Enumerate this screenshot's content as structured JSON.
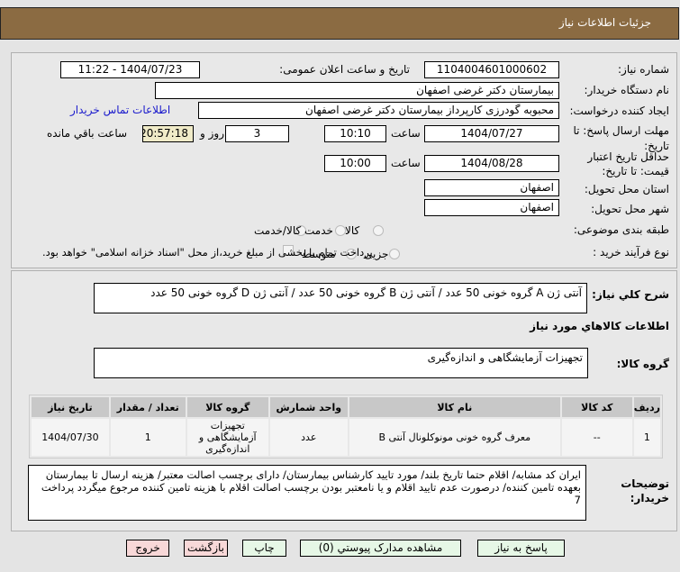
{
  "header": {
    "title": "جزئیات اطلاعات نیاز"
  },
  "form": {
    "need_number_label": "شماره نیاز:",
    "need_number": "1104004601000602",
    "announce_label": "تاریخ و ساعت اعلان عمومی:",
    "announce_value": "1404/07/23 - 11:22",
    "buyer_label": "نام دستگاه خریدار:",
    "buyer": "بیمارستان دکتر غرضی اصفهان",
    "creator_label": "ایجاد کننده درخواست:",
    "creator": "محبوبه گودرزی کارپرداز بیمارستان دکتر غرضی اصفهان",
    "contact_link": "اطلاعات تماس خریدار",
    "deadline_label_1": "مهلت ارسال پاسخ: تا",
    "deadline_label_2": "تاریخ:",
    "deadline_date": "1404/07/27",
    "time_label": "ساعت",
    "deadline_time": "10:10",
    "days": "3",
    "days_label": "روز و",
    "remaining": "20:57:18",
    "remaining_label": "ساعت باقي مانده",
    "validity_label_1": "حداقل تاریخ اعتبار",
    "validity_label_2": "قیمت: تا تاریخ:",
    "validity_date": "1404/08/28",
    "validity_time": "10:00",
    "province_label": "استان محل تحویل:",
    "province": "اصفهان",
    "city_label": "شهر محل تحویل:",
    "city": "اصفهان",
    "category_label": "طبقه بندی موضوعی:",
    "category_options": [
      "کالا",
      "خدمت",
      "کالا/خدمت"
    ],
    "process_label": "نوع فرآیند خرید :",
    "process_options": [
      "جزیی",
      "متوسط"
    ],
    "payment_note": "پرداخت تمام یا بخشی از مبلغ خرید،از محل \"اسناد خزانه اسلامی\" خواهد بود."
  },
  "description": {
    "label": "شرح کلي نياز:",
    "value": "آنتی ژن A گروه خونی 50 عدد / آنتی ژن B گروه خونی 50 عدد / آنتی ژن D گروه خونی 50 عدد"
  },
  "goods_title": "اطلاعات كالاهاي مورد نياز",
  "goods_group": {
    "label": "گروه کالا:",
    "value": "تجهیزات آزمایشگاهی و اندازه‌گیری"
  },
  "table": {
    "headers": [
      "ردیف",
      "کد کالا",
      "نام کالا",
      "واحد شمارش",
      "گروه کالا",
      "تعداد / مقدار",
      "تاریخ نیاز"
    ],
    "rows": [
      [
        "1",
        "--",
        "معرف گروه خونی مونوکلونال آنتی B",
        "عدد",
        "تجهیزات آزمایشگاهی و اندازه‌گیری",
        "1",
        "1404/07/30"
      ]
    ]
  },
  "notes": {
    "label_1": "توضیحات",
    "label_2": "خریدار:",
    "value": "ایران کد مشابه/ اقلام حتما تاریخ بلند/ مورد تایید کارشناس بیمارستان/ دارای برچسب اصالت معتبر/ هزینه ارسال تا بیمارستان بعهده تامین کننده/ درصورت عدم تایید اقلام و یا نامعتبر بودن برچسب اصالت اقلام با هزینه تامین کننده مرجوع میگردد پرداخت 7"
  },
  "buttons": {
    "reply": "پاسخ به نیاز",
    "attachments": "مشاهده مدارک پیوستي (0)",
    "print": "چاپ",
    "back": "بازگشت",
    "exit": "خروج"
  }
}
